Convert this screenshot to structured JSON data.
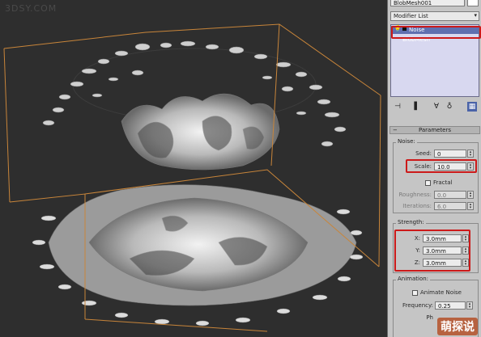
{
  "watermark_top": "3DSY.COM",
  "object_name": "BlobMesh001",
  "modifier_list": {
    "label": "Modifier List"
  },
  "stack": [
    {
      "label": "Noise",
      "selected": true
    },
    {
      "label": "BlobMesh",
      "selected": false
    }
  ],
  "parameters_header": "Parameters",
  "noise_group": {
    "title": "Noise:",
    "seed": {
      "label": "Seed:",
      "value": "0"
    },
    "scale": {
      "label": "Scale:",
      "value": "10.0"
    },
    "fractal": {
      "label": "Fractal",
      "checked": false
    },
    "roughness": {
      "label": "Roughness:",
      "value": "0.0"
    },
    "iterations": {
      "label": "Iterations:",
      "value": "6.0"
    }
  },
  "strength_group": {
    "title": "Strength:",
    "x": {
      "label": "X:",
      "value": "3.0mm"
    },
    "y": {
      "label": "Y:",
      "value": "3.0mm"
    },
    "z": {
      "label": "Z:",
      "value": "3.0mm"
    }
  },
  "animation_group": {
    "title": "Animation:",
    "animate_noise": {
      "label": "Animate Noise",
      "checked": false
    },
    "frequency": {
      "label": "Frequency:",
      "value": "0.25"
    },
    "phase": {
      "label": "Ph"
    }
  },
  "corner_watermark": "萌探说",
  "colors": {
    "viewport_bg": "#2e2e2e",
    "panel_bg": "#c5c5c5",
    "highlight_red": "#cc1a1a",
    "bounding_box": "#c8853a"
  }
}
